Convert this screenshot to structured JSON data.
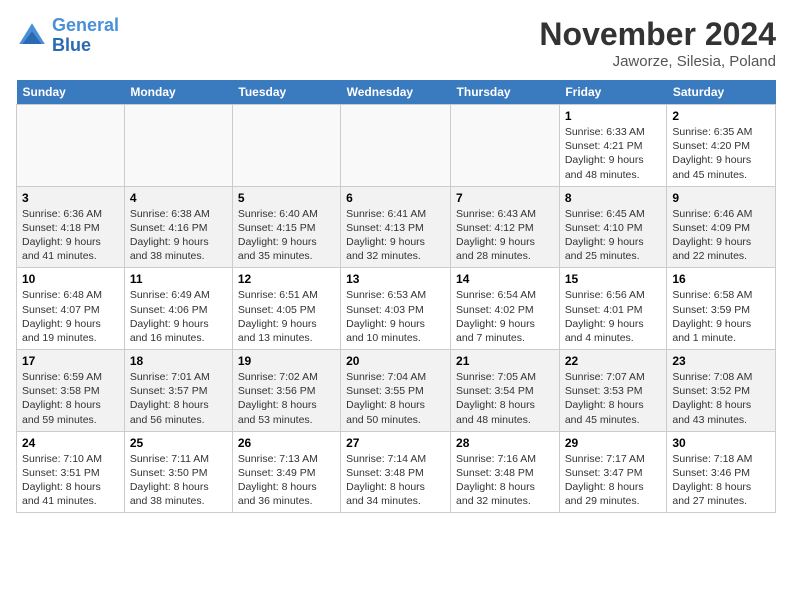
{
  "header": {
    "logo_line1": "General",
    "logo_line2": "Blue",
    "title": "November 2024",
    "subtitle": "Jaworze, Silesia, Poland"
  },
  "weekdays": [
    "Sunday",
    "Monday",
    "Tuesday",
    "Wednesday",
    "Thursday",
    "Friday",
    "Saturday"
  ],
  "weeks": [
    [
      {
        "day": "",
        "info": ""
      },
      {
        "day": "",
        "info": ""
      },
      {
        "day": "",
        "info": ""
      },
      {
        "day": "",
        "info": ""
      },
      {
        "day": "",
        "info": ""
      },
      {
        "day": "1",
        "info": "Sunrise: 6:33 AM\nSunset: 4:21 PM\nDaylight: 9 hours and 48 minutes."
      },
      {
        "day": "2",
        "info": "Sunrise: 6:35 AM\nSunset: 4:20 PM\nDaylight: 9 hours and 45 minutes."
      }
    ],
    [
      {
        "day": "3",
        "info": "Sunrise: 6:36 AM\nSunset: 4:18 PM\nDaylight: 9 hours and 41 minutes."
      },
      {
        "day": "4",
        "info": "Sunrise: 6:38 AM\nSunset: 4:16 PM\nDaylight: 9 hours and 38 minutes."
      },
      {
        "day": "5",
        "info": "Sunrise: 6:40 AM\nSunset: 4:15 PM\nDaylight: 9 hours and 35 minutes."
      },
      {
        "day": "6",
        "info": "Sunrise: 6:41 AM\nSunset: 4:13 PM\nDaylight: 9 hours and 32 minutes."
      },
      {
        "day": "7",
        "info": "Sunrise: 6:43 AM\nSunset: 4:12 PM\nDaylight: 9 hours and 28 minutes."
      },
      {
        "day": "8",
        "info": "Sunrise: 6:45 AM\nSunset: 4:10 PM\nDaylight: 9 hours and 25 minutes."
      },
      {
        "day": "9",
        "info": "Sunrise: 6:46 AM\nSunset: 4:09 PM\nDaylight: 9 hours and 22 minutes."
      }
    ],
    [
      {
        "day": "10",
        "info": "Sunrise: 6:48 AM\nSunset: 4:07 PM\nDaylight: 9 hours and 19 minutes."
      },
      {
        "day": "11",
        "info": "Sunrise: 6:49 AM\nSunset: 4:06 PM\nDaylight: 9 hours and 16 minutes."
      },
      {
        "day": "12",
        "info": "Sunrise: 6:51 AM\nSunset: 4:05 PM\nDaylight: 9 hours and 13 minutes."
      },
      {
        "day": "13",
        "info": "Sunrise: 6:53 AM\nSunset: 4:03 PM\nDaylight: 9 hours and 10 minutes."
      },
      {
        "day": "14",
        "info": "Sunrise: 6:54 AM\nSunset: 4:02 PM\nDaylight: 9 hours and 7 minutes."
      },
      {
        "day": "15",
        "info": "Sunrise: 6:56 AM\nSunset: 4:01 PM\nDaylight: 9 hours and 4 minutes."
      },
      {
        "day": "16",
        "info": "Sunrise: 6:58 AM\nSunset: 3:59 PM\nDaylight: 9 hours and 1 minute."
      }
    ],
    [
      {
        "day": "17",
        "info": "Sunrise: 6:59 AM\nSunset: 3:58 PM\nDaylight: 8 hours and 59 minutes."
      },
      {
        "day": "18",
        "info": "Sunrise: 7:01 AM\nSunset: 3:57 PM\nDaylight: 8 hours and 56 minutes."
      },
      {
        "day": "19",
        "info": "Sunrise: 7:02 AM\nSunset: 3:56 PM\nDaylight: 8 hours and 53 minutes."
      },
      {
        "day": "20",
        "info": "Sunrise: 7:04 AM\nSunset: 3:55 PM\nDaylight: 8 hours and 50 minutes."
      },
      {
        "day": "21",
        "info": "Sunrise: 7:05 AM\nSunset: 3:54 PM\nDaylight: 8 hours and 48 minutes."
      },
      {
        "day": "22",
        "info": "Sunrise: 7:07 AM\nSunset: 3:53 PM\nDaylight: 8 hours and 45 minutes."
      },
      {
        "day": "23",
        "info": "Sunrise: 7:08 AM\nSunset: 3:52 PM\nDaylight: 8 hours and 43 minutes."
      }
    ],
    [
      {
        "day": "24",
        "info": "Sunrise: 7:10 AM\nSunset: 3:51 PM\nDaylight: 8 hours and 41 minutes."
      },
      {
        "day": "25",
        "info": "Sunrise: 7:11 AM\nSunset: 3:50 PM\nDaylight: 8 hours and 38 minutes."
      },
      {
        "day": "26",
        "info": "Sunrise: 7:13 AM\nSunset: 3:49 PM\nDaylight: 8 hours and 36 minutes."
      },
      {
        "day": "27",
        "info": "Sunrise: 7:14 AM\nSunset: 3:48 PM\nDaylight: 8 hours and 34 minutes."
      },
      {
        "day": "28",
        "info": "Sunrise: 7:16 AM\nSunset: 3:48 PM\nDaylight: 8 hours and 32 minutes."
      },
      {
        "day": "29",
        "info": "Sunrise: 7:17 AM\nSunset: 3:47 PM\nDaylight: 8 hours and 29 minutes."
      },
      {
        "day": "30",
        "info": "Sunrise: 7:18 AM\nSunset: 3:46 PM\nDaylight: 8 hours and 27 minutes."
      }
    ]
  ]
}
